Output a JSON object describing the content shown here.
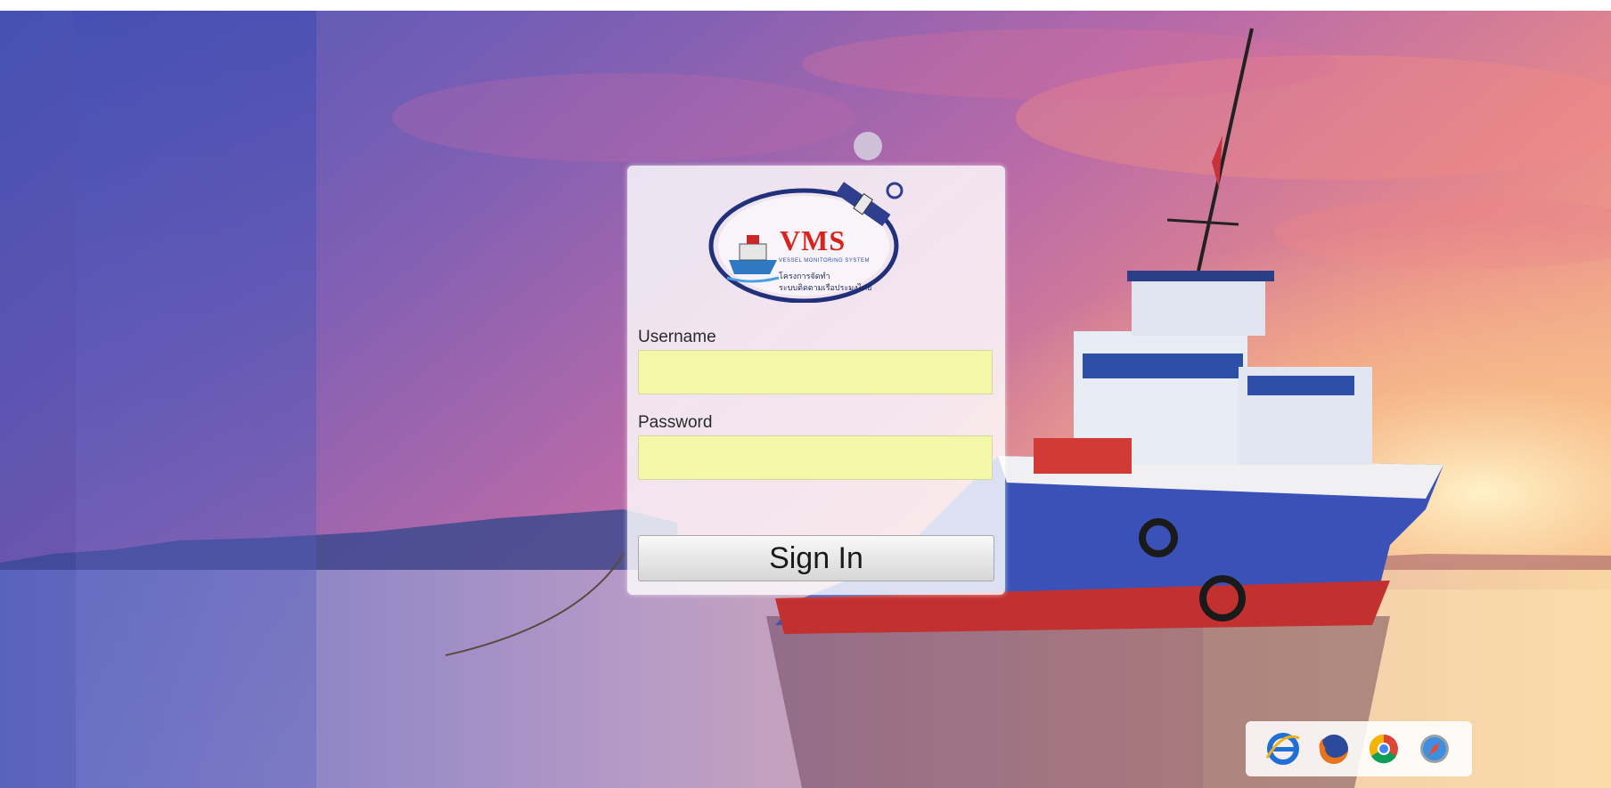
{
  "login": {
    "logo": {
      "title": "VMS",
      "subtitle": "VESSEL MONITORING SYSTEM",
      "line1": "โครงการจัดทำ",
      "line2": "ระบบติดตามเรือประมงไทย"
    },
    "username_label": "Username",
    "username_value": "",
    "password_label": "Password",
    "password_value": "",
    "signin_label": "Sign In"
  },
  "browsers": [
    {
      "icon": "internet-explorer-icon"
    },
    {
      "icon": "firefox-icon"
    },
    {
      "icon": "chrome-icon"
    },
    {
      "icon": "safari-icon"
    }
  ],
  "colors": {
    "input_background": "#f3f7a7",
    "logo_red": "#d8241f",
    "logo_navy": "#1b2a5a"
  }
}
